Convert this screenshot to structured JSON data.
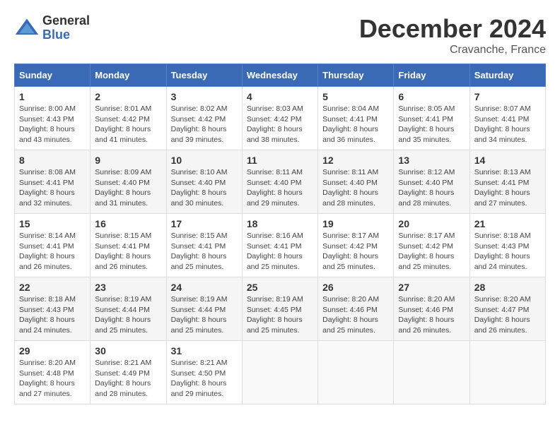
{
  "logo": {
    "line1": "General",
    "line2": "Blue"
  },
  "header": {
    "month": "December 2024",
    "location": "Cravanche, France"
  },
  "weekdays": [
    "Sunday",
    "Monday",
    "Tuesday",
    "Wednesday",
    "Thursday",
    "Friday",
    "Saturday"
  ],
  "weeks": [
    [
      {
        "day": "1",
        "sunrise": "Sunrise: 8:00 AM",
        "sunset": "Sunset: 4:43 PM",
        "daylight": "Daylight: 8 hours and 43 minutes."
      },
      {
        "day": "2",
        "sunrise": "Sunrise: 8:01 AM",
        "sunset": "Sunset: 4:42 PM",
        "daylight": "Daylight: 8 hours and 41 minutes."
      },
      {
        "day": "3",
        "sunrise": "Sunrise: 8:02 AM",
        "sunset": "Sunset: 4:42 PM",
        "daylight": "Daylight: 8 hours and 39 minutes."
      },
      {
        "day": "4",
        "sunrise": "Sunrise: 8:03 AM",
        "sunset": "Sunset: 4:42 PM",
        "daylight": "Daylight: 8 hours and 38 minutes."
      },
      {
        "day": "5",
        "sunrise": "Sunrise: 8:04 AM",
        "sunset": "Sunset: 4:41 PM",
        "daylight": "Daylight: 8 hours and 36 minutes."
      },
      {
        "day": "6",
        "sunrise": "Sunrise: 8:05 AM",
        "sunset": "Sunset: 4:41 PM",
        "daylight": "Daylight: 8 hours and 35 minutes."
      },
      {
        "day": "7",
        "sunrise": "Sunrise: 8:07 AM",
        "sunset": "Sunset: 4:41 PM",
        "daylight": "Daylight: 8 hours and 34 minutes."
      }
    ],
    [
      {
        "day": "8",
        "sunrise": "Sunrise: 8:08 AM",
        "sunset": "Sunset: 4:41 PM",
        "daylight": "Daylight: 8 hours and 32 minutes."
      },
      {
        "day": "9",
        "sunrise": "Sunrise: 8:09 AM",
        "sunset": "Sunset: 4:40 PM",
        "daylight": "Daylight: 8 hours and 31 minutes."
      },
      {
        "day": "10",
        "sunrise": "Sunrise: 8:10 AM",
        "sunset": "Sunset: 4:40 PM",
        "daylight": "Daylight: 8 hours and 30 minutes."
      },
      {
        "day": "11",
        "sunrise": "Sunrise: 8:11 AM",
        "sunset": "Sunset: 4:40 PM",
        "daylight": "Daylight: 8 hours and 29 minutes."
      },
      {
        "day": "12",
        "sunrise": "Sunrise: 8:11 AM",
        "sunset": "Sunset: 4:40 PM",
        "daylight": "Daylight: 8 hours and 28 minutes."
      },
      {
        "day": "13",
        "sunrise": "Sunrise: 8:12 AM",
        "sunset": "Sunset: 4:40 PM",
        "daylight": "Daylight: 8 hours and 28 minutes."
      },
      {
        "day": "14",
        "sunrise": "Sunrise: 8:13 AM",
        "sunset": "Sunset: 4:41 PM",
        "daylight": "Daylight: 8 hours and 27 minutes."
      }
    ],
    [
      {
        "day": "15",
        "sunrise": "Sunrise: 8:14 AM",
        "sunset": "Sunset: 4:41 PM",
        "daylight": "Daylight: 8 hours and 26 minutes."
      },
      {
        "day": "16",
        "sunrise": "Sunrise: 8:15 AM",
        "sunset": "Sunset: 4:41 PM",
        "daylight": "Daylight: 8 hours and 26 minutes."
      },
      {
        "day": "17",
        "sunrise": "Sunrise: 8:15 AM",
        "sunset": "Sunset: 4:41 PM",
        "daylight": "Daylight: 8 hours and 25 minutes."
      },
      {
        "day": "18",
        "sunrise": "Sunrise: 8:16 AM",
        "sunset": "Sunset: 4:41 PM",
        "daylight": "Daylight: 8 hours and 25 minutes."
      },
      {
        "day": "19",
        "sunrise": "Sunrise: 8:17 AM",
        "sunset": "Sunset: 4:42 PM",
        "daylight": "Daylight: 8 hours and 25 minutes."
      },
      {
        "day": "20",
        "sunrise": "Sunrise: 8:17 AM",
        "sunset": "Sunset: 4:42 PM",
        "daylight": "Daylight: 8 hours and 25 minutes."
      },
      {
        "day": "21",
        "sunrise": "Sunrise: 8:18 AM",
        "sunset": "Sunset: 4:43 PM",
        "daylight": "Daylight: 8 hours and 24 minutes."
      }
    ],
    [
      {
        "day": "22",
        "sunrise": "Sunrise: 8:18 AM",
        "sunset": "Sunset: 4:43 PM",
        "daylight": "Daylight: 8 hours and 24 minutes."
      },
      {
        "day": "23",
        "sunrise": "Sunrise: 8:19 AM",
        "sunset": "Sunset: 4:44 PM",
        "daylight": "Daylight: 8 hours and 25 minutes."
      },
      {
        "day": "24",
        "sunrise": "Sunrise: 8:19 AM",
        "sunset": "Sunset: 4:44 PM",
        "daylight": "Daylight: 8 hours and 25 minutes."
      },
      {
        "day": "25",
        "sunrise": "Sunrise: 8:19 AM",
        "sunset": "Sunset: 4:45 PM",
        "daylight": "Daylight: 8 hours and 25 minutes."
      },
      {
        "day": "26",
        "sunrise": "Sunrise: 8:20 AM",
        "sunset": "Sunset: 4:46 PM",
        "daylight": "Daylight: 8 hours and 25 minutes."
      },
      {
        "day": "27",
        "sunrise": "Sunrise: 8:20 AM",
        "sunset": "Sunset: 4:46 PM",
        "daylight": "Daylight: 8 hours and 26 minutes."
      },
      {
        "day": "28",
        "sunrise": "Sunrise: 8:20 AM",
        "sunset": "Sunset: 4:47 PM",
        "daylight": "Daylight: 8 hours and 26 minutes."
      }
    ],
    [
      {
        "day": "29",
        "sunrise": "Sunrise: 8:20 AM",
        "sunset": "Sunset: 4:48 PM",
        "daylight": "Daylight: 8 hours and 27 minutes."
      },
      {
        "day": "30",
        "sunrise": "Sunrise: 8:21 AM",
        "sunset": "Sunset: 4:49 PM",
        "daylight": "Daylight: 8 hours and 28 minutes."
      },
      {
        "day": "31",
        "sunrise": "Sunrise: 8:21 AM",
        "sunset": "Sunset: 4:50 PM",
        "daylight": "Daylight: 8 hours and 29 minutes."
      },
      null,
      null,
      null,
      null
    ]
  ]
}
